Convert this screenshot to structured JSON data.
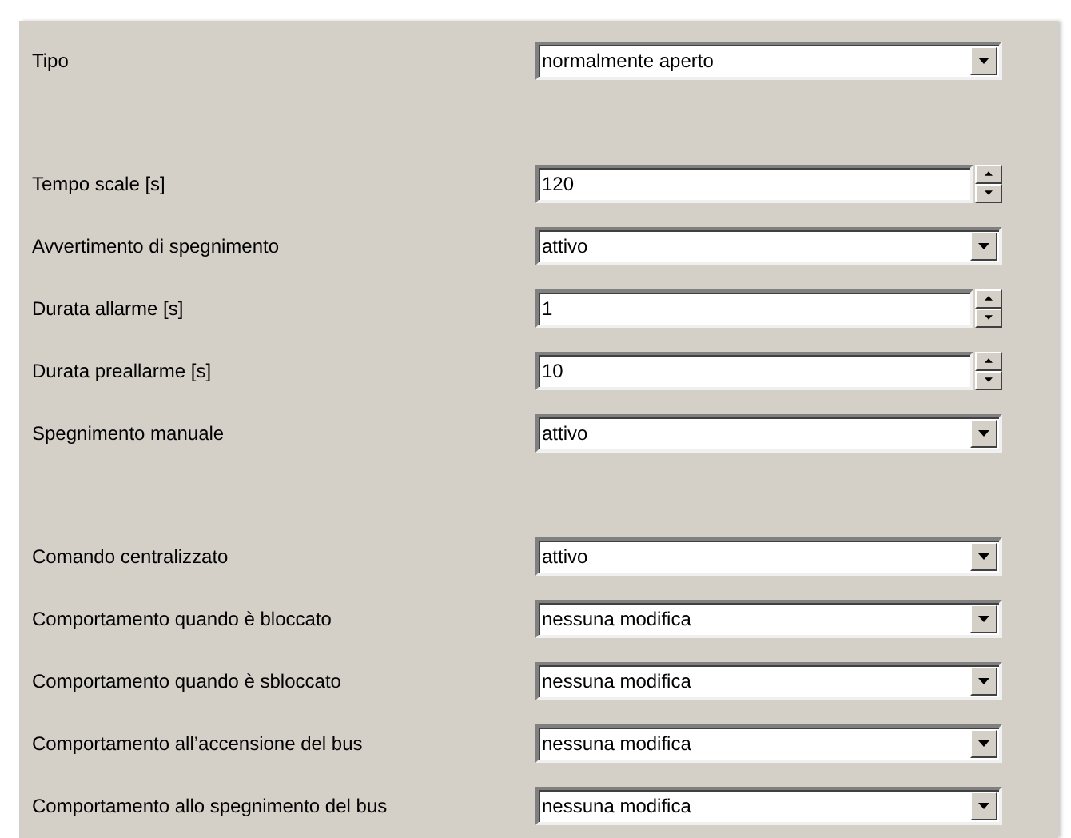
{
  "groups": [
    {
      "rows": [
        {
          "label": "Tipo",
          "kind": "dropdown",
          "value": "normalmente aperto"
        }
      ]
    },
    {
      "rows": [
        {
          "label": "Tempo scale [s]",
          "kind": "spinner",
          "value": "120"
        },
        {
          "label": "Avvertimento di spegnimento",
          "kind": "dropdown",
          "value": "attivo"
        },
        {
          "label": "Durata allarme [s]",
          "kind": "spinner",
          "value": "1"
        },
        {
          "label": "Durata preallarme [s]",
          "kind": "spinner",
          "value": "10"
        },
        {
          "label": "Spegnimento manuale",
          "kind": "dropdown",
          "value": "attivo"
        }
      ]
    },
    {
      "rows": [
        {
          "label": "Comando centralizzato",
          "kind": "dropdown",
          "value": "attivo"
        },
        {
          "label": "Comportamento quando è bloccato",
          "kind": "dropdown",
          "value": "nessuna modifica"
        },
        {
          "label": "Comportamento quando è sbloccato",
          "kind": "dropdown",
          "value": "nessuna modifica"
        },
        {
          "label": "Comportamento all’accensione del bus",
          "kind": "dropdown",
          "value": "nessuna modifica"
        },
        {
          "label": "Comportamento allo spegnimento del bus",
          "kind": "dropdown",
          "value": "nessuna modifica"
        }
      ]
    }
  ]
}
